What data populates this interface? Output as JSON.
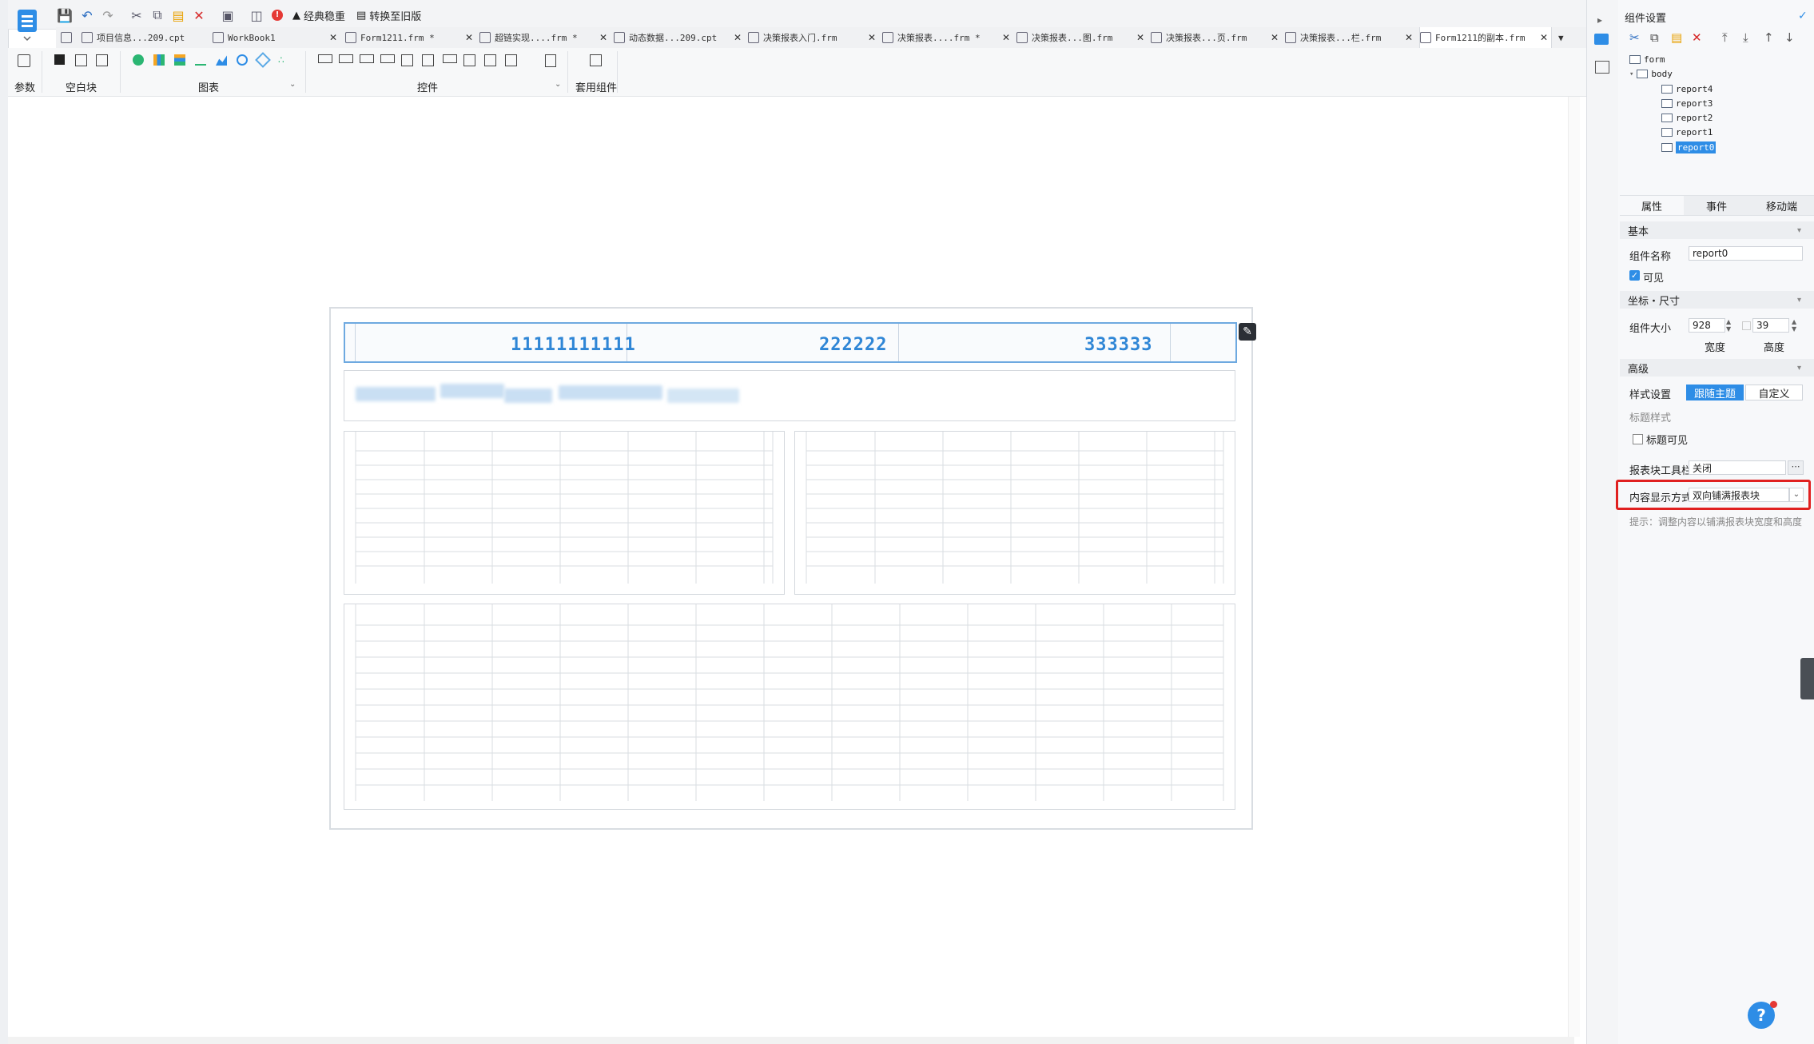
{
  "toolbar": {
    "classic_theme_label": "经典稳重",
    "convert_old_label": "转换至旧版"
  },
  "tabs": [
    {
      "label": "项目信息...209.cpt",
      "active": false
    },
    {
      "label": "WorkBook1",
      "active": false
    },
    {
      "label": "Form1211.frm *",
      "active": false
    },
    {
      "label": "超链实现....frm *",
      "active": false
    },
    {
      "label": "动态数据...209.cpt",
      "active": false
    },
    {
      "label": "决策报表入门.frm",
      "active": false
    },
    {
      "label": "决策报表....frm *",
      "active": false
    },
    {
      "label": "决策报表...图.frm",
      "active": false
    },
    {
      "label": "决策报表...页.frm",
      "active": false
    },
    {
      "label": "决策报表...栏.frm",
      "active": false
    },
    {
      "label": "Form1211的副本.frm",
      "active": true
    }
  ],
  "component_toolbar": {
    "groups": [
      "参数",
      "空白块",
      "图表",
      "控件",
      "套用组件"
    ]
  },
  "canvas": {
    "report0_cells": [
      "11111111111",
      "222222",
      "333333"
    ]
  },
  "right_panel": {
    "title": "组件设置",
    "tree": [
      {
        "label": "form",
        "level": 0,
        "selected": false
      },
      {
        "label": "body",
        "level": 1,
        "selected": false
      },
      {
        "label": "report4",
        "level": 2,
        "selected": false
      },
      {
        "label": "report3",
        "level": 2,
        "selected": false
      },
      {
        "label": "report2",
        "level": 2,
        "selected": false
      },
      {
        "label": "report1",
        "level": 2,
        "selected": false
      },
      {
        "label": "report0",
        "level": 2,
        "selected": true
      }
    ],
    "prop_tabs": [
      "属性",
      "事件",
      "移动端"
    ],
    "sections": {
      "basic": "基本",
      "position_size": "坐标・尺寸",
      "advanced": "高级"
    },
    "component_name_label": "组件名称",
    "component_name_value": "report0",
    "visible_label": "可见",
    "visible_checked": true,
    "size_label": "组件大小",
    "width_value": "928",
    "height_value": "39",
    "width_caption": "宽度",
    "height_caption": "高度",
    "style_setting_label": "样式设置",
    "style_follow_theme": "跟随主题",
    "style_custom": "自定义",
    "title_style_label": "标题样式",
    "title_visible_label": "标题可见",
    "title_visible_checked": false,
    "toolbar_label": "报表块工具栏",
    "toolbar_value": "关闭",
    "content_display_label": "内容显示方式",
    "content_display_value": "双向铺满报表块",
    "hint": "提示：调整内容以铺满报表块宽度和高度"
  },
  "colors": {
    "accent": "#2e8de6",
    "highlight": "#e02020",
    "report_text": "#2f86d6"
  }
}
